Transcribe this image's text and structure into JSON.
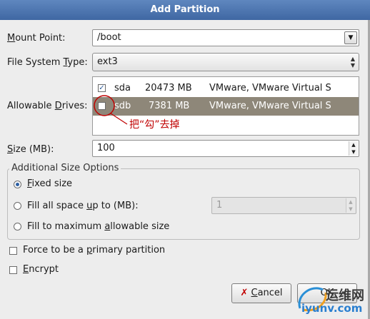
{
  "window": {
    "title": "Add Partition"
  },
  "mount_point": {
    "label_pre": "M",
    "label_post": "ount Point:",
    "value": "/boot"
  },
  "file_system_type": {
    "label_pre": "File System ",
    "label_ul": "T",
    "label_post": "ype:",
    "value": "ext3"
  },
  "allowable_drives": {
    "label_pre": "Allowable ",
    "label_ul": "D",
    "label_post": "rives:",
    "drives": [
      {
        "checked": "✓",
        "name": "sda",
        "size": "20473 MB",
        "model": "VMware, VMware Virtual S"
      },
      {
        "checked": "",
        "name": "sdb",
        "size": "7381 MB",
        "model": "VMware, VMware Virtual S"
      }
    ]
  },
  "annotation": {
    "text": "把“勾”去掉",
    "color": "#c00000"
  },
  "size": {
    "label_ul": "S",
    "label_post": "ize (MB):",
    "value": "100"
  },
  "additional_size_options": {
    "title": "Additional Size Options",
    "fixed": {
      "label_ul": "F",
      "label_post": "ixed size",
      "selected": true
    },
    "fill_upto": {
      "label_pre": "Fill all space ",
      "label_ul": "u",
      "label_post": "p to (MB):",
      "value": "1"
    },
    "fill_max": {
      "label_pre": "Fill to maximum ",
      "label_ul": "a",
      "label_post": "llowable size"
    }
  },
  "force_primary": {
    "label_pre": "Force to be a ",
    "label_ul": "p",
    "label_post": "rimary partition"
  },
  "encrypt": {
    "label_ul": "E",
    "label_post": "ncrypt"
  },
  "buttons": {
    "cancel_ul": "C",
    "cancel_post": "ancel",
    "ok": "OK"
  },
  "watermark": {
    "line1": "运维网",
    "line2": "iyunv.com"
  }
}
